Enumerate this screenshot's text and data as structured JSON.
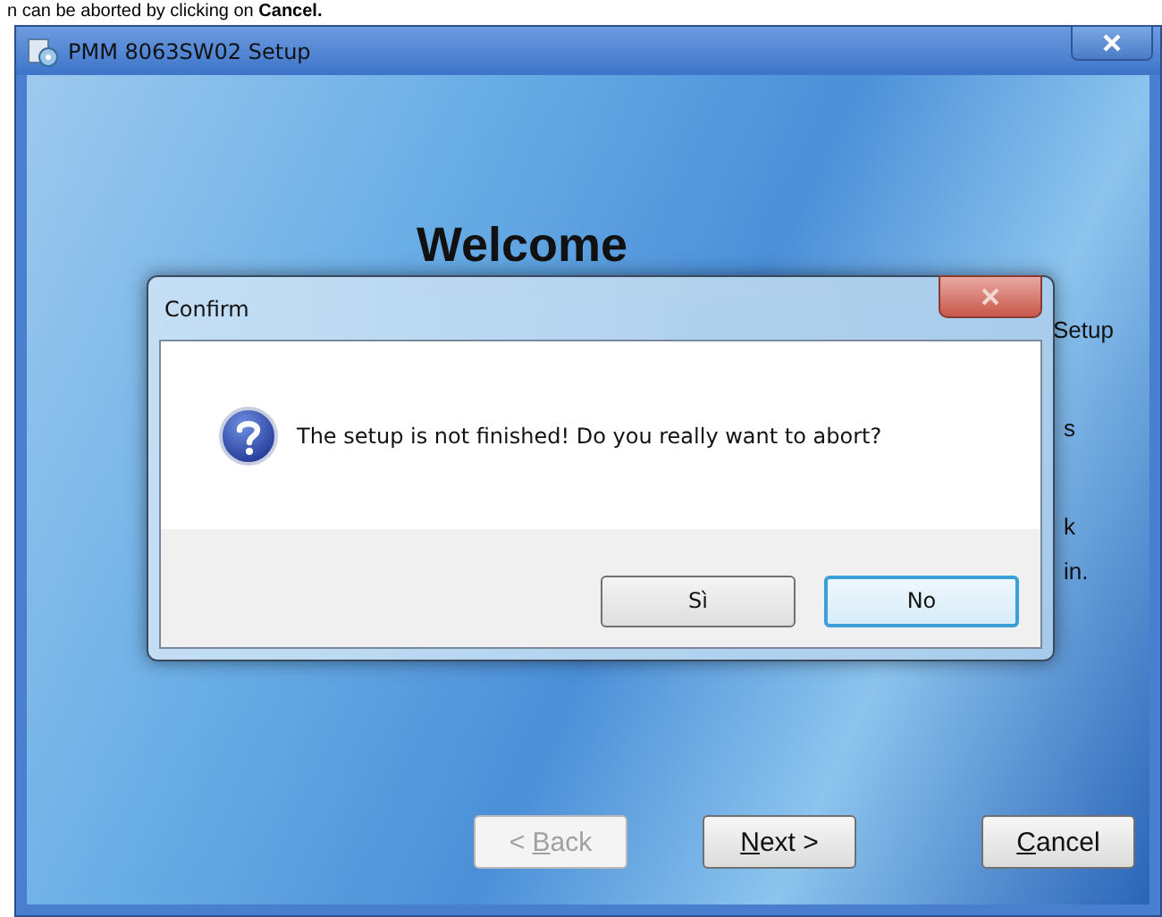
{
  "page_caption": {
    "text": "n can be aborted by clicking on **Cancel.**"
  },
  "window": {
    "title": "PMM 8063SW02 Setup"
  },
  "welcome": {
    "heading": "Welcome",
    "fragments": [
      "Setup",
      "s",
      "k",
      "in."
    ]
  },
  "wizard_buttons": [
    {
      "label": "< Back",
      "access_key_underlined": true,
      "disabled": true,
      "selected": false
    },
    {
      "label": "Next >",
      "access_key_underlined": true,
      "disabled": false,
      "selected": false
    },
    {
      "label": "Cancel",
      "access_key_underlined": true,
      "disabled": false,
      "selected": false
    }
  ],
  "dialog": {
    "title": "Confirm",
    "message": "The setup is not finished! Do you really want to abort?",
    "buttons": [
      {
        "label": "Sì",
        "selected": false
      },
      {
        "label": "No",
        "selected": true
      }
    ]
  }
}
